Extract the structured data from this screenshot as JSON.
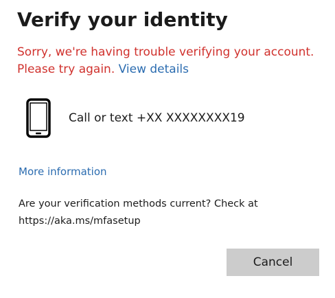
{
  "dialog": {
    "title": "Verify your identity",
    "error_text": "Sorry, we're having trouble verifying your account. Please try again. ",
    "error_link": "View details",
    "method": {
      "icon": "mobile-phone-icon",
      "label": "Call or text +XX XXXXXXXX19"
    },
    "more_info_link": "More information",
    "note": "Are your verification methods current? Check at https://aka.ms/mfasetup",
    "cancel_label": "Cancel"
  },
  "colors": {
    "error": "#d0312d",
    "link": "#2b6cb0",
    "button_bg": "#cccccc",
    "text": "#1b1b1b"
  }
}
